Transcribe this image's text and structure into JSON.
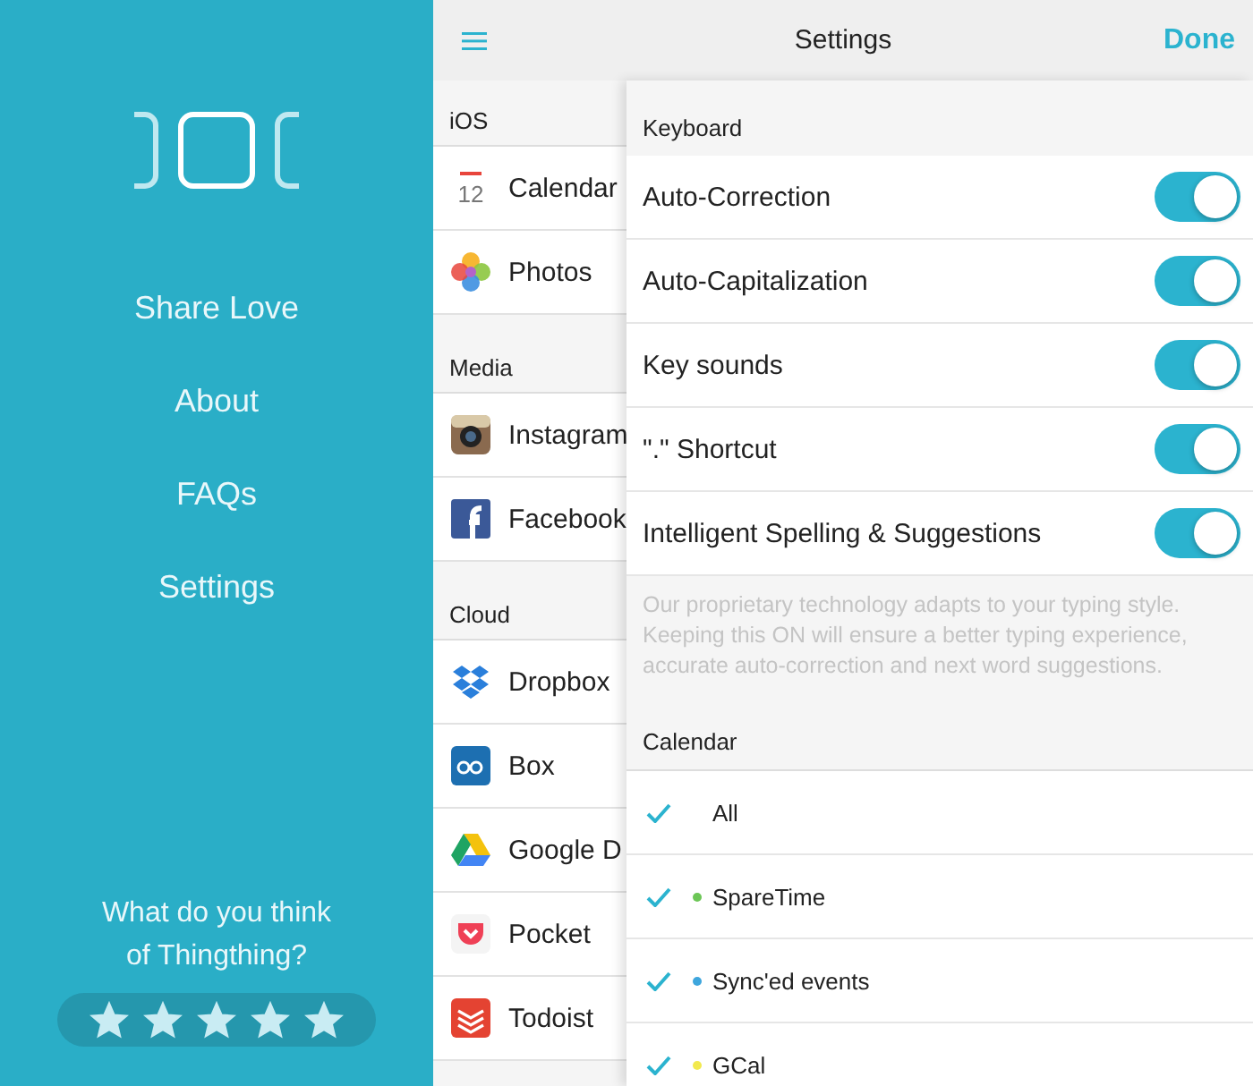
{
  "side_menu": {
    "items": [
      "Share Love",
      "About",
      "FAQs",
      "Settings"
    ],
    "feedback": {
      "question": "What do you think of Thingthing?",
      "stars": 5
    }
  },
  "header": {
    "title": "Settings",
    "done": "Done"
  },
  "sources": [
    {
      "title": "iOS",
      "items": [
        {
          "label": "Calendar",
          "icon_day": "12"
        },
        {
          "label": "Photos"
        }
      ]
    },
    {
      "title": "Media",
      "items": [
        {
          "label": "Instagram"
        },
        {
          "label": "Facebook"
        }
      ]
    },
    {
      "title": "Cloud",
      "items": [
        {
          "label": "Dropbox"
        },
        {
          "label": "Box"
        },
        {
          "label": "Google D"
        },
        {
          "label": "Pocket"
        },
        {
          "label": "Todoist"
        }
      ]
    }
  ],
  "keyboard": {
    "title": "Keyboard",
    "toggles": [
      {
        "label": "Auto-Correction",
        "on": true
      },
      {
        "label": "Auto-Capitalization",
        "on": true
      },
      {
        "label": "Key sounds",
        "on": true
      },
      {
        "label": "\".\" Shortcut",
        "on": true
      },
      {
        "label": "Intelligent Spelling & Suggestions",
        "on": true
      }
    ],
    "note": "Our proprietary technology adapts to your typing style. Keeping this ON will ensure a better typing experience, accurate auto-correction and next word suggestions."
  },
  "calendar": {
    "title": "Calendar",
    "items": [
      {
        "label": "All",
        "checked": true
      },
      {
        "label": "SpareTime",
        "checked": true,
        "color": "#6cc656"
      },
      {
        "label": "Sync'ed events",
        "checked": true,
        "color": "#3ea6dd"
      },
      {
        "label": "GCal",
        "checked": true,
        "color": "#f2e94e"
      }
    ]
  }
}
